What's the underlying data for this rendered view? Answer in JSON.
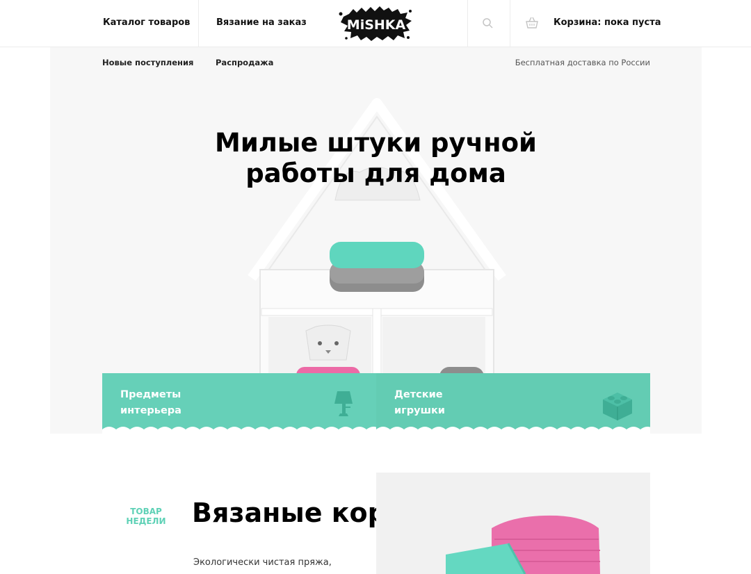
{
  "header": {
    "catalog_label": "Каталог товаров",
    "custom_knit_label": "Вязание на заказ",
    "logo_text": "MiSHKA",
    "cart_label": "Корзина: пока пуста",
    "search_icon": "search-icon",
    "cart_icon": "basket-icon"
  },
  "subnav": {
    "new_label": "Новые поступления",
    "sale_label": "Распродажа",
    "delivery_text": "Бесплатная доставка по России"
  },
  "hero": {
    "title_line1": "Милые штуки ручной",
    "title_line2": "работы для дома"
  },
  "categories": [
    {
      "line1": "Предметы",
      "line2": "интерьера",
      "icon": "lamp-icon"
    },
    {
      "line1": "Детские",
      "line2": "игрушки",
      "icon": "toy-block-icon"
    }
  ],
  "week": {
    "tag_line1": "ТОВАР",
    "tag_line2": "НЕДЕЛИ",
    "title": "Вязаные корзинки",
    "description": "Экологически чистая пряжа,"
  },
  "colors": {
    "accent": "#66d0b8",
    "accent_dark": "#4fb49c",
    "hero_bg": "#f7f7f7",
    "text": "#111111"
  }
}
